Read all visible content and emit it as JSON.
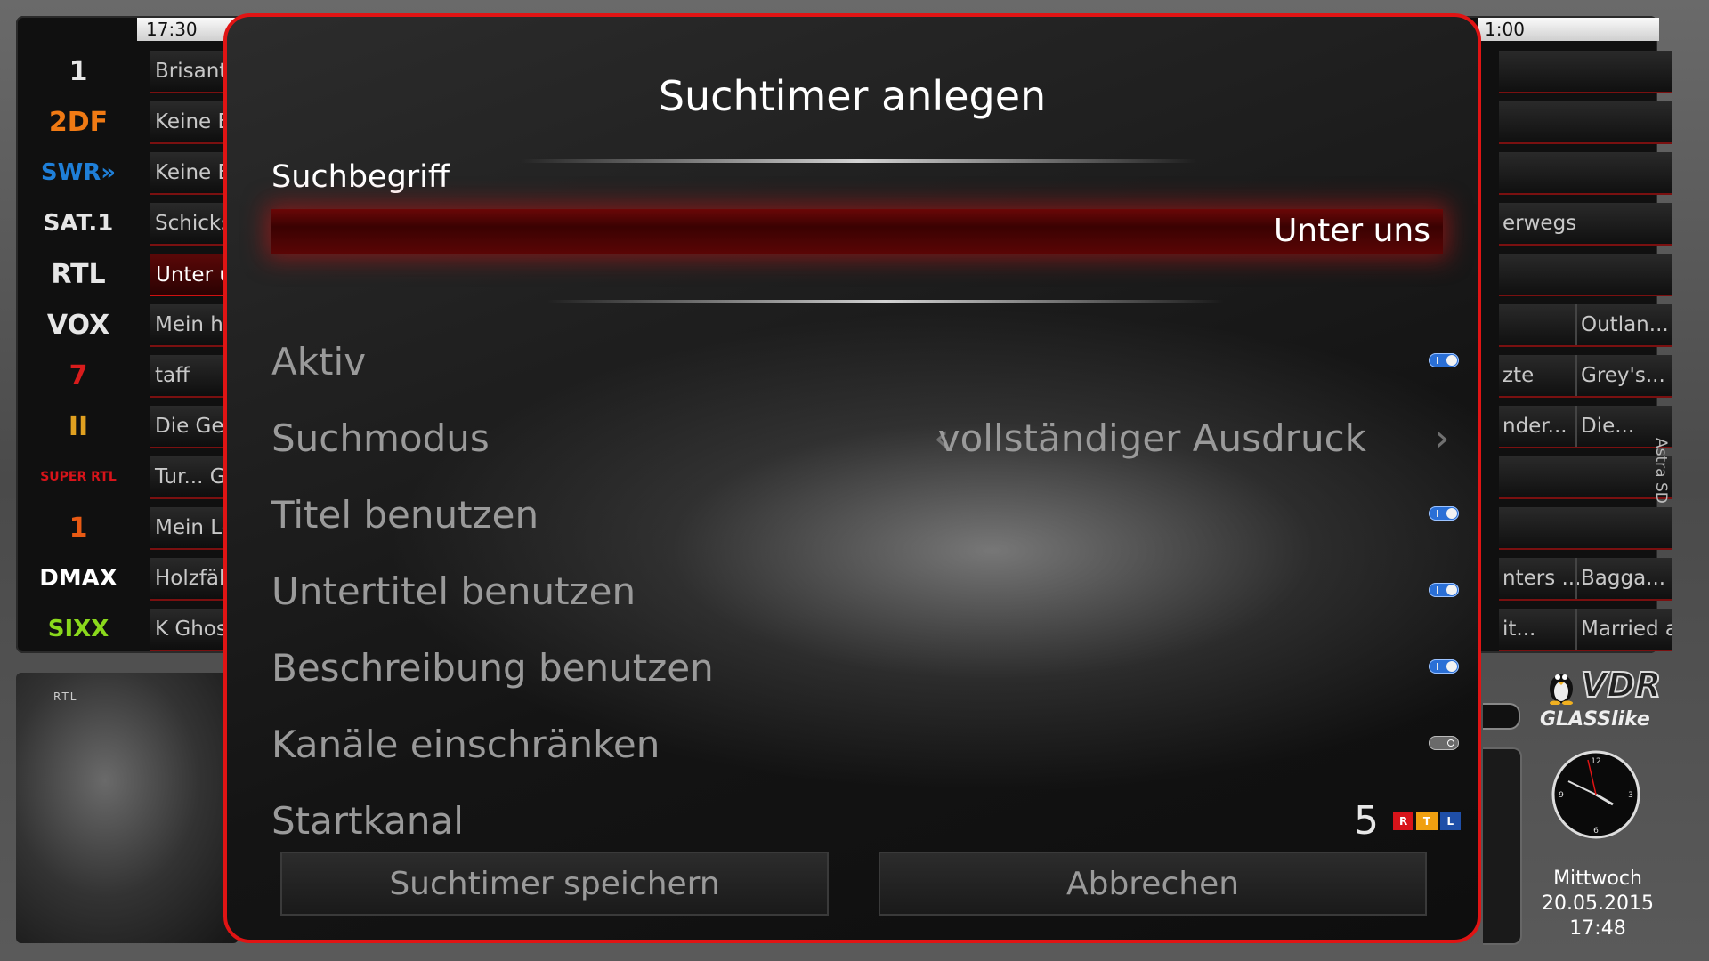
{
  "epg": {
    "time_left": "17:30",
    "time_right": "1:00",
    "channels": [
      {
        "logo": "Das Erste",
        "logo_text": "1",
        "left": "Brisant",
        "right": "",
        "right2": ""
      },
      {
        "logo": "ZDF",
        "logo_text": "2DF",
        "left": "Keine E",
        "right": "",
        "right2": ""
      },
      {
        "logo": "SWR",
        "logo_text": "SWR»",
        "left": "Keine E",
        "right": "",
        "right2": ""
      },
      {
        "logo": "SAT.1",
        "logo_text": "SAT.1",
        "left": "Schicksa",
        "right": "erwegs",
        "right2": ""
      },
      {
        "logo": "RTL",
        "logo_text": "RTL",
        "left": "Unter un",
        "right": "",
        "right2": ""
      },
      {
        "logo": "VOX",
        "logo_text": "VOX",
        "left": "Mein hin",
        "right": "",
        "right2": "Outlan..."
      },
      {
        "logo": "ProSieben",
        "logo_text": "7",
        "left": "taff",
        "right": "zte",
        "right2": "Grey's..."
      },
      {
        "logo": "RTL II",
        "logo_text": "II",
        "left": "Die Geis",
        "right": "nder...",
        "right2": "Die..."
      },
      {
        "logo": "SUPER RTL",
        "logo_text": "SUPER RTL",
        "left": "Tur... Go",
        "right": "",
        "right2": ""
      },
      {
        "logo": "kabel eins",
        "logo_text": "1",
        "left": "Mein Lok",
        "right": "",
        "right2": ""
      },
      {
        "logo": "DMAX",
        "logo_text": "DMAX",
        "left": "Holzfälle",
        "right": "nters ...",
        "right2": "Bagga..."
      },
      {
        "logo": "sixx",
        "logo_text": "SIXX",
        "left": "K Ghost",
        "right": "it...",
        "right2": "Married at..."
      }
    ],
    "selected_index": 4,
    "source_label": "Astra SD"
  },
  "branding": {
    "vdr": "VDR",
    "skin": "GLASSlike"
  },
  "datetime": {
    "weekday": "Mittwoch",
    "date": "20.05.2015",
    "time": "17:48"
  },
  "dialog": {
    "title": "Suchtimer anlegen",
    "search_label": "Suchbegriff",
    "search_value": "Unter uns",
    "rows": {
      "active": {
        "label": "Aktiv",
        "on": true
      },
      "mode": {
        "label": "Suchmodus",
        "value": "vollständiger Ausdruck"
      },
      "use_title": {
        "label": "Titel benutzen",
        "on": true
      },
      "use_subtitle": {
        "label": "Untertitel benutzen",
        "on": true
      },
      "use_description": {
        "label": "Beschreibung benutzen",
        "on": true
      },
      "limit_channels": {
        "label": "Kanäle einschränken",
        "on": false
      },
      "start_channel": {
        "label": "Startkanal",
        "value": "5",
        "channel_logo": "RTL"
      }
    },
    "buttons": {
      "save": "Suchtimer speichern",
      "cancel": "Abbrechen"
    }
  },
  "colors": {
    "accent_red": "#e01414",
    "toggle_on": "#2a6fd6"
  }
}
